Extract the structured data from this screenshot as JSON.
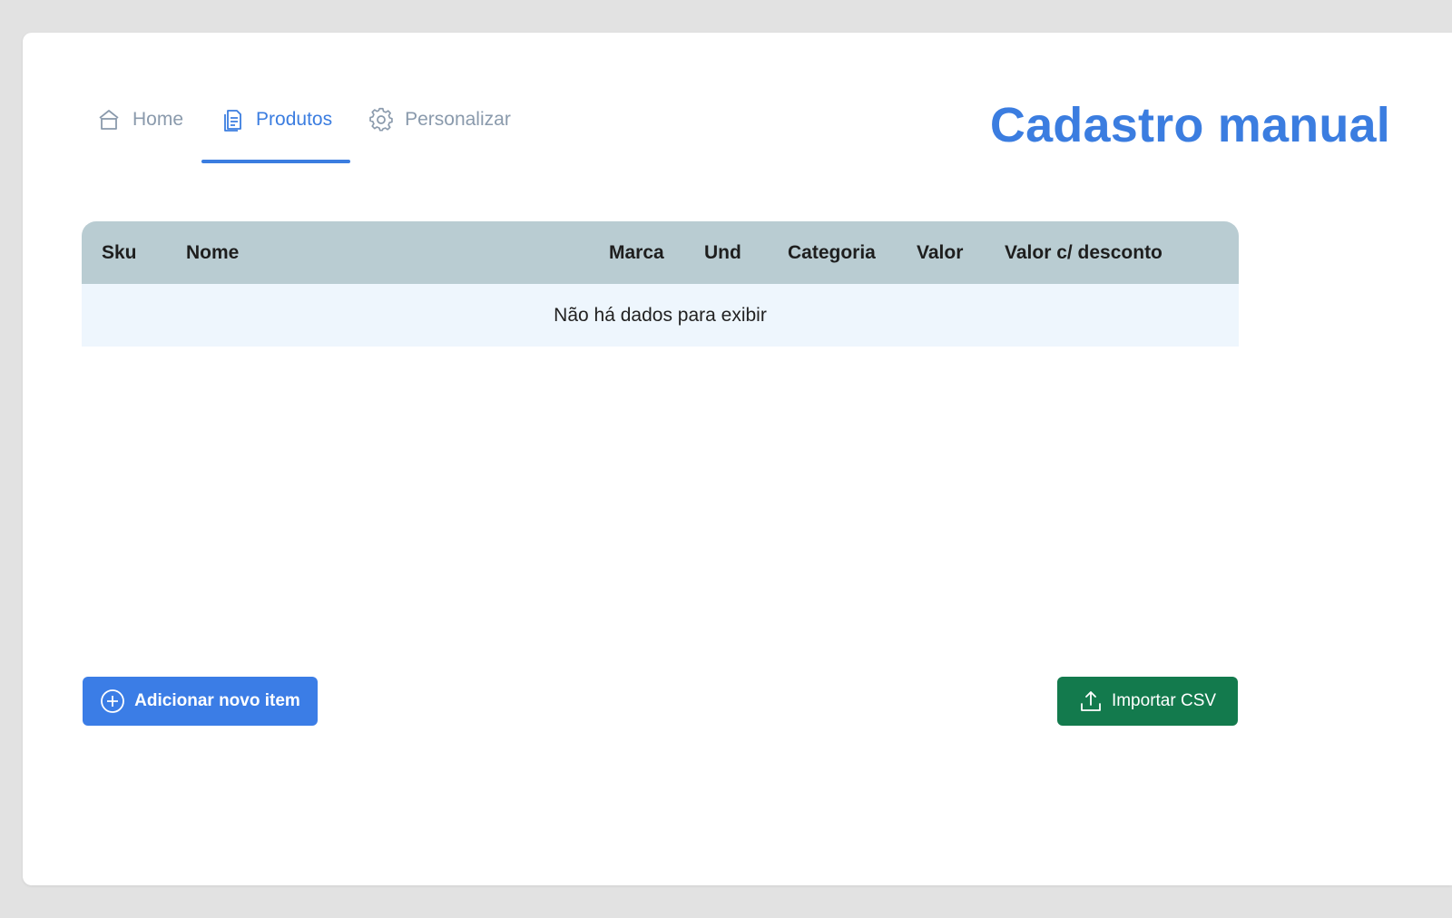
{
  "nav": {
    "tabs": [
      {
        "label": "Home",
        "icon": "home-icon",
        "active": false
      },
      {
        "label": "Produtos",
        "icon": "document-icon",
        "active": true
      },
      {
        "label": "Personalizar",
        "icon": "gear-icon",
        "active": false
      }
    ]
  },
  "header": {
    "title": "Cadastro manual"
  },
  "table": {
    "columns": [
      "Sku",
      "Nome",
      "Marca",
      "Und",
      "Categoria",
      "Valor",
      "Valor c/ desconto"
    ],
    "empty_message": "Não há dados para exibir"
  },
  "actions": {
    "add_label": "Adicionar novo item",
    "import_label": "Importar CSV"
  },
  "colors": {
    "accent": "#3b7de0",
    "tab_inactive": "#8a9aac",
    "table_header": "#b9ccd2",
    "table_body": "#eef6fd",
    "import_button": "#137a4d",
    "background": "#e2e2e2"
  }
}
